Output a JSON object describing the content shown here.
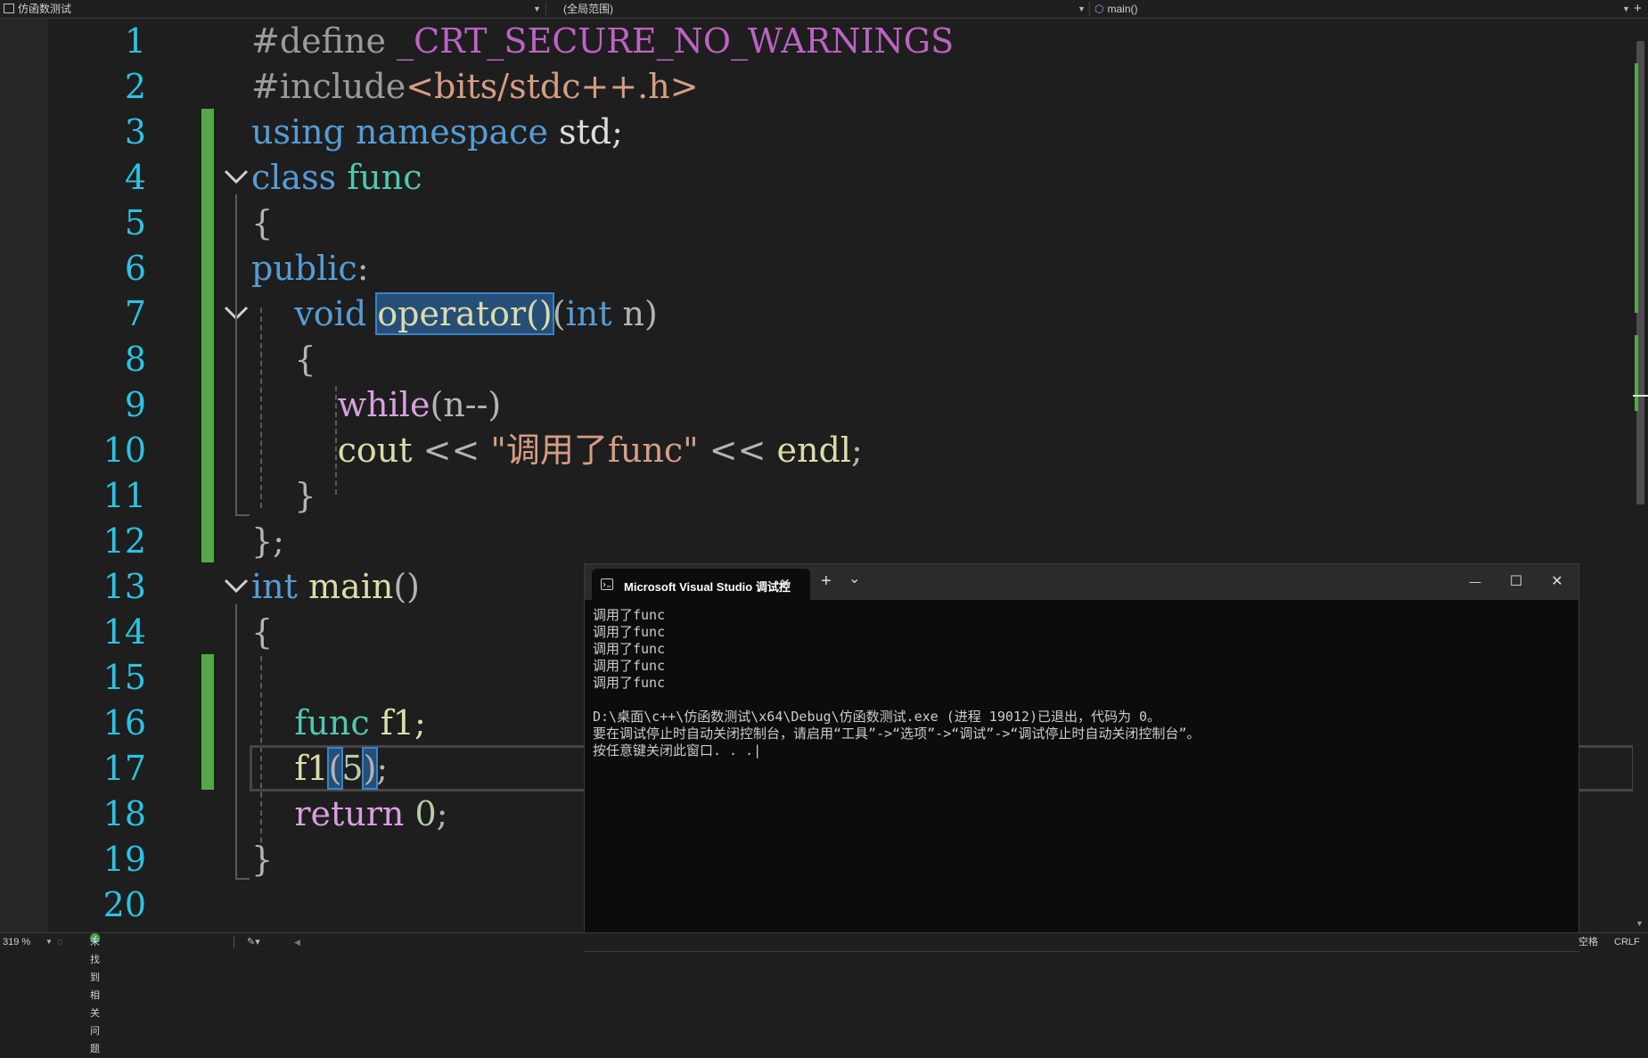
{
  "nav": {
    "project": "仿函数测试",
    "scope": "(全局范围)",
    "member": "main()"
  },
  "line_numbers": [
    "1",
    "2",
    "3",
    "4",
    "5",
    "6",
    "7",
    "8",
    "9",
    "10",
    "11",
    "12",
    "13",
    "14",
    "15",
    "16",
    "17",
    "18",
    "19",
    "20"
  ],
  "code": {
    "l1_directive": "#define",
    "l1_macro": "_CRT_SECURE_NO_WARNINGS",
    "l2_directive": "#include",
    "l2_header": "<bits/stdc++.h>",
    "l3_using": "using",
    "l3_namespace": "namespace",
    "l3_rest": " std;",
    "l4_class": "class",
    "l4_name": "func",
    "l5": "{",
    "l6_public": "public",
    "l6_colon": ":",
    "l7_void": "void",
    "l7_operator": "operator()",
    "l7_open": "(",
    "l7_int": "int",
    "l7_rest": " n)",
    "l8": "{",
    "l9_while": "while",
    "l9_rest": "(n--)",
    "l10_cout": "cout",
    "l10_op": " << ",
    "l10_str": "\"调用了func\"",
    "l10_op2": " << ",
    "l10_endl": "endl",
    "l10_semi": ";",
    "l11": "}",
    "l12": "};",
    "l13_int": "int",
    "l13_main": "main",
    "l13_parens": "()",
    "l14": "{",
    "l16_type": "func",
    "l16_rest": " f1;",
    "l17_name": "f1",
    "l17_open": "(",
    "l17_arg": "5",
    "l17_close": ")",
    "l17_semi": ";",
    "l18_return": "return",
    "l18_num": "0",
    "l18_semi": ";",
    "l19": "}"
  },
  "console": {
    "tab_title": "Microsoft Visual Studio 调试控",
    "new_tab": "+",
    "dropdown": "⌄",
    "minimize": "—",
    "maximize": "☐",
    "close": "✕",
    "tab_close": "✕",
    "output": "调用了func\n调用了func\n调用了func\n调用了func\n调用了func\n\nD:\\桌面\\c++\\仿函数测试\\x64\\Debug\\仿函数测试.exe (进程 19012)已退出，代码为 0。\n要在调试停止时自动关闭控制台，请启用“工具”->“选项”->“调试”->“调试停止时自动关闭控制台”。\n按任意键关闭此窗口. . .|"
  },
  "status": {
    "zoom": "319 %",
    "issues": "未找到相关问题",
    "indent": "空格",
    "line_ending": "CRLF"
  },
  "colors": {
    "keyword": "#569cd6",
    "type": "#4ec9b0",
    "string": "#d69d85",
    "control": "#d8a0df",
    "macro": "#bd63c5",
    "function": "#dcdcaa",
    "number": "#b5cea8",
    "line_number": "#2bc3e4",
    "change_bar": "#57a64a"
  }
}
